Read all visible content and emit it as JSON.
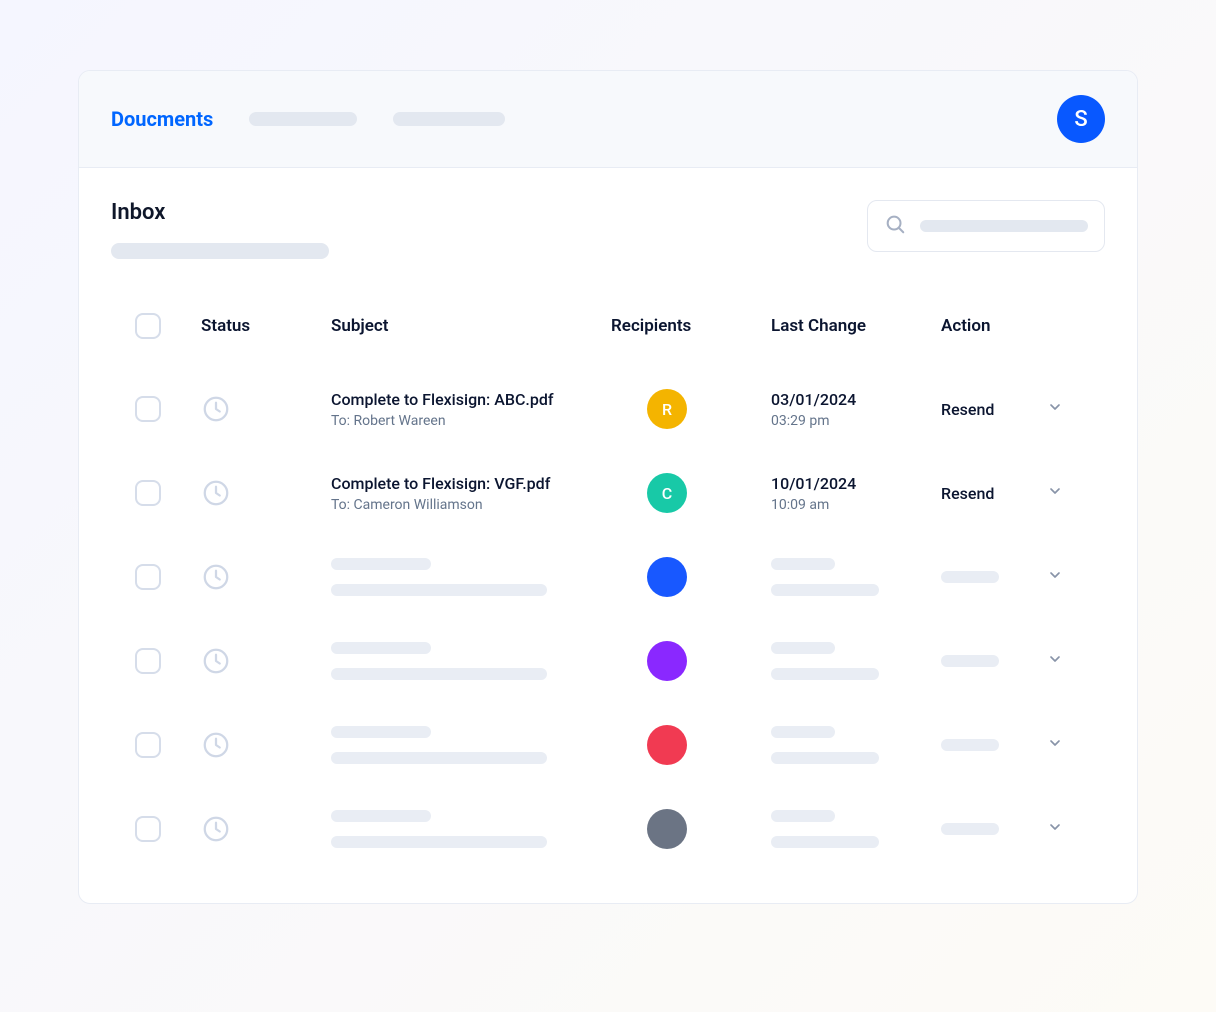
{
  "header": {
    "title": "Doucments",
    "avatar_initial": "S"
  },
  "page": {
    "title": "Inbox"
  },
  "columns": {
    "status": "Status",
    "subject": "Subject",
    "recipients": "Recipients",
    "last_change": "Last Change",
    "action": "Action"
  },
  "rows": [
    {
      "subject": "Complete to Flexisign: ABC.pdf",
      "to": "To: Robert Wareen",
      "recipient_initial": "R",
      "recipient_color": "#f4b400",
      "date": "03/01/2024",
      "time": "03:29 pm",
      "action": "Resend",
      "placeholder": false
    },
    {
      "subject": "Complete to Flexisign: VGF.pdf",
      "to": "To: Cameron Williamson",
      "recipient_initial": "C",
      "recipient_color": "#18c9a7",
      "date": "10/01/2024",
      "time": "10:09 am",
      "action": "Resend",
      "placeholder": false
    },
    {
      "recipient_color": "#1858ff",
      "placeholder": true
    },
    {
      "recipient_color": "#8a28ff",
      "placeholder": true
    },
    {
      "recipient_color": "#f13a52",
      "placeholder": true
    },
    {
      "recipient_color": "#6b7484",
      "placeholder": true
    }
  ],
  "icons": {
    "search": "search-icon",
    "clock": "clock-icon",
    "chevron": "chevron-down-icon"
  }
}
